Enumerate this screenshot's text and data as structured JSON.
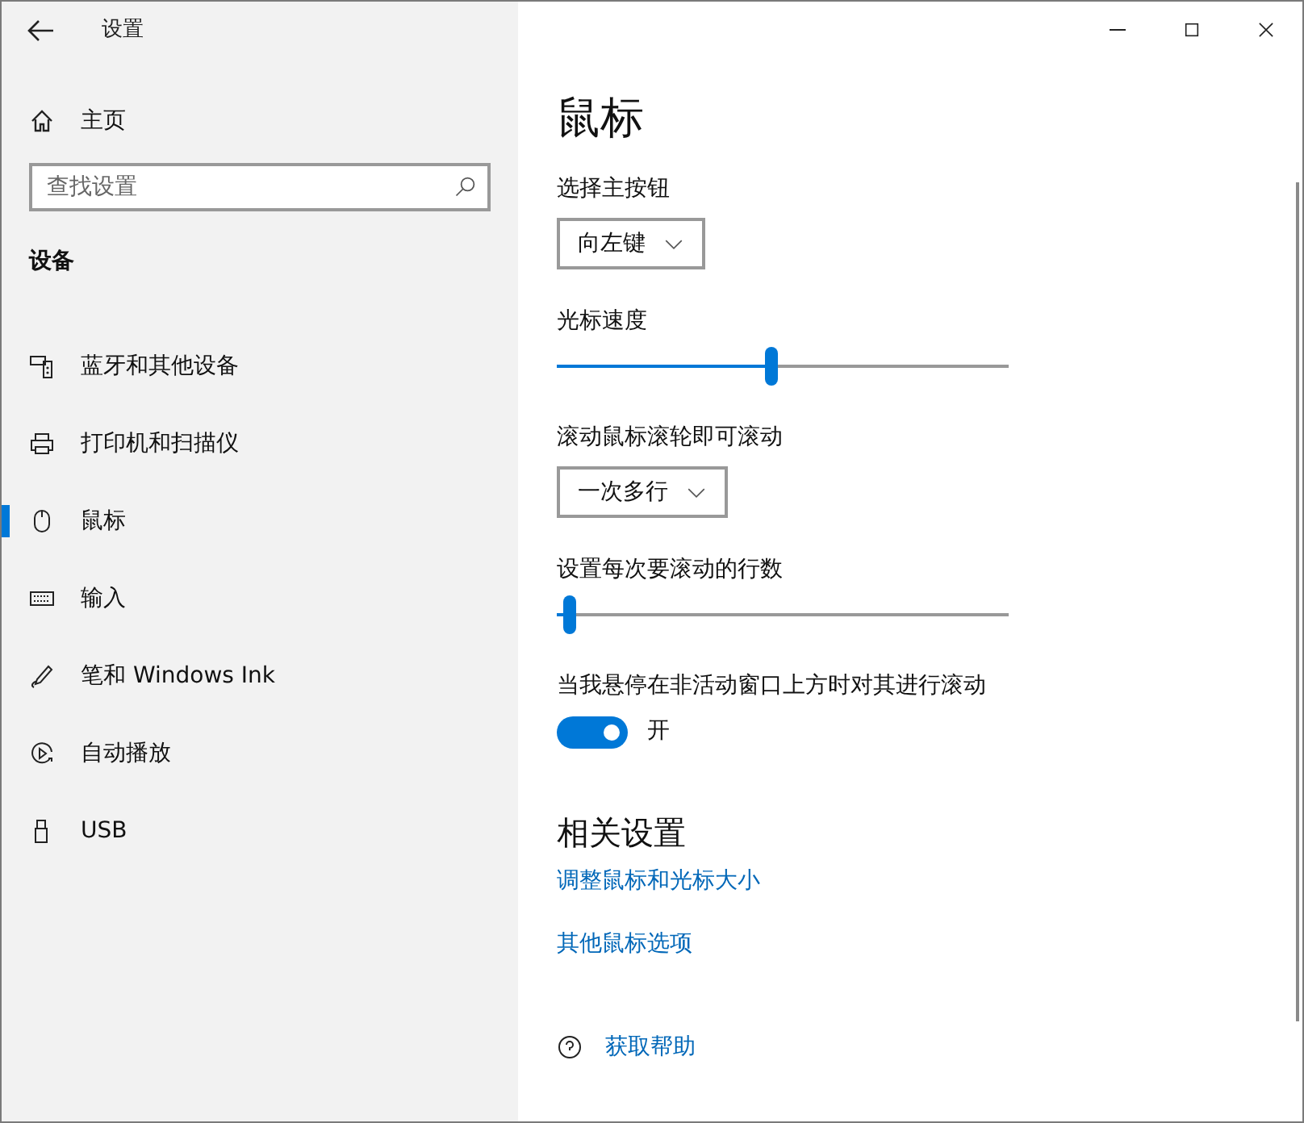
{
  "window": {
    "title": "设置"
  },
  "sidebar": {
    "home": "主页",
    "search": {
      "placeholder": "查找设置"
    },
    "section": "设备",
    "items": [
      {
        "label": "蓝牙和其他设备",
        "kind": "bluetooth",
        "selected": false
      },
      {
        "label": "打印机和扫描仪",
        "kind": "printer",
        "selected": false
      },
      {
        "label": "鼠标",
        "kind": "mouse",
        "selected": true
      },
      {
        "label": "输入",
        "kind": "keyboard",
        "selected": false
      },
      {
        "label": "笔和 Windows Ink",
        "kind": "pen",
        "selected": false
      },
      {
        "label": "自动播放",
        "kind": "autoplay",
        "selected": false
      },
      {
        "label": "USB",
        "kind": "usb",
        "selected": false
      }
    ]
  },
  "page": {
    "title": "鼠标",
    "settings": [
      {
        "kind": "dropdown",
        "label": "选择主按钮",
        "value": "向左键"
      },
      {
        "kind": "slider",
        "label": "光标速度",
        "level": 0.475
      },
      {
        "kind": "dropdown",
        "label": "滚动鼠标滚轮即可滚动",
        "value": "一次多行"
      },
      {
        "kind": "slider",
        "label": "设置每次要滚动的行数",
        "level": 0.03
      },
      {
        "kind": "toggle",
        "label": "当我悬停在非活动窗口上方时对其进行滚动",
        "on": true,
        "state_text": "开"
      }
    ],
    "related": {
      "title": "相关设置",
      "links": [
        "调整鼠标和光标大小",
        "其他鼠标选项"
      ]
    },
    "help_link": "获取帮助"
  }
}
